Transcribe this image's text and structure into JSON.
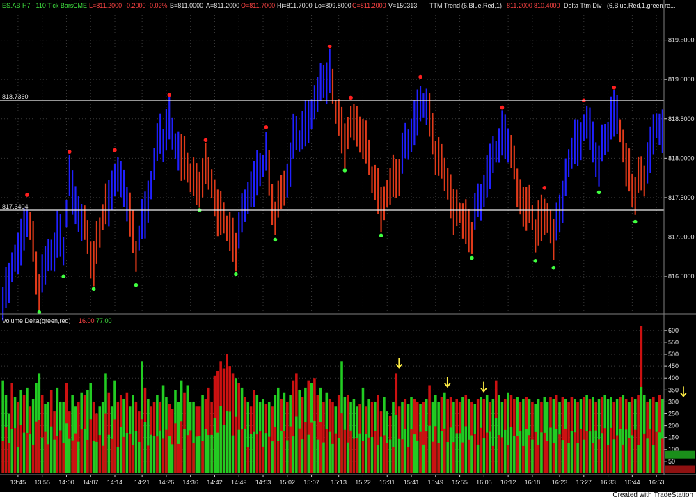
{
  "header": {
    "symbol": "ES.AB H7 - 110 Tick Bars",
    "exchange": "CME",
    "last": "L=811.2000",
    "change": "-0.2000",
    "change_pct": "-0.02%",
    "bid": "B=811.0000",
    "ask": "A=811.2000",
    "open": "O=811.7000",
    "high": "Hi=811.7000",
    "low": "Lo=809.8000",
    "close": "C=811.2000",
    "volume": "V=150313",
    "indicator1": "TTM Trend",
    "indicator1_params": "(6,Blue,Red,1)",
    "indicator1_val1": "811.2000",
    "indicator1_val2": "810.4000",
    "indicator2": "Delta Ttm Div",
    "indicator2_params": "(6,Blue,Red,1,green,re..."
  },
  "volume_header": {
    "title": "Volume Delta",
    "params": "(green,red)",
    "val_red": "16.00",
    "val_green": "77.00"
  },
  "footer_text": "Created with TradeStation",
  "colors": {
    "up_bar": "#2020ff",
    "down_bar": "#e03a1a",
    "delta_green": "#22cc22",
    "delta_red": "#cc1111",
    "dot_red": "#ff2020",
    "dot_green": "#40ff40",
    "arrow": "#ffee44",
    "grid": "#3a3a3a"
  },
  "chart_data": [
    {
      "type": "candlestick",
      "name": "ES.AB H7 - 110 Tick Bars",
      "x_ticks": [
        "13:45",
        "13:55",
        "14:00",
        "14:07",
        "14:14",
        "14:21",
        "14:26",
        "14:36",
        "14:42",
        "14:49",
        "14:53",
        "15:02",
        "15:07",
        "15:13",
        "15:22",
        "15:31",
        "15:41",
        "15:49",
        "15:55",
        "16:05",
        "16:12",
        "16:18",
        "16:23",
        "16:27",
        "16:33",
        "16:44",
        "16:53"
      ],
      "y_ticks": [
        "816.5000",
        "817.0000",
        "817.5000",
        "818.0000",
        "818.5000",
        "819.0000",
        "819.5000"
      ],
      "ylim": [
        816.05,
        819.85
      ],
      "lines": [
        {
          "label": "818.7360",
          "value": 818.736
        },
        {
          "label": "817.3404",
          "value": 817.34
        }
      ],
      "close_path": [
        [
          0,
          816.2,
          "d"
        ],
        [
          6,
          816.95,
          "u"
        ],
        [
          8,
          817.25,
          "u"
        ],
        [
          10,
          816.85,
          "d"
        ],
        [
          12,
          816.4,
          "d"
        ],
        [
          15,
          816.7,
          "u"
        ],
        [
          18,
          817.0,
          "u"
        ],
        [
          20,
          816.9,
          "u"
        ],
        [
          22,
          817.7,
          "u"
        ],
        [
          26,
          817.2,
          "u"
        ],
        [
          30,
          816.7,
          "d"
        ],
        [
          34,
          817.4,
          "d"
        ],
        [
          38,
          817.8,
          "u"
        ],
        [
          41,
          817.5,
          "u"
        ],
        [
          44,
          816.8,
          "d"
        ],
        [
          48,
          817.5,
          "u"
        ],
        [
          52,
          818.3,
          "u"
        ],
        [
          55,
          818.4,
          "u"
        ],
        [
          58,
          818.1,
          "u"
        ],
        [
          61,
          817.9,
          "d"
        ],
        [
          64,
          817.6,
          "d"
        ],
        [
          67,
          817.9,
          "d"
        ],
        [
          70,
          817.5,
          "d"
        ],
        [
          74,
          817.1,
          "d"
        ],
        [
          77,
          816.9,
          "d"
        ],
        [
          80,
          817.4,
          "u"
        ],
        [
          84,
          817.8,
          "u"
        ],
        [
          87,
          818.0,
          "u"
        ],
        [
          90,
          817.3,
          "d"
        ],
        [
          93,
          817.6,
          "d"
        ],
        [
          96,
          818.2,
          "u"
        ],
        [
          100,
          818.4,
          "u"
        ],
        [
          103,
          818.7,
          "u"
        ],
        [
          106,
          819.0,
          "u"
        ],
        [
          108,
          819.1,
          "u"
        ],
        [
          110,
          818.6,
          "d"
        ],
        [
          113,
          818.25,
          "d"
        ],
        [
          116,
          818.45,
          "d"
        ],
        [
          119,
          818.3,
          "d"
        ],
        [
          122,
          817.8,
          "d"
        ],
        [
          125,
          817.4,
          "d"
        ],
        [
          128,
          817.6,
          "d"
        ],
        [
          131,
          817.9,
          "d"
        ],
        [
          134,
          818.2,
          "u"
        ],
        [
          137,
          818.6,
          "u"
        ],
        [
          140,
          818.7,
          "u"
        ],
        [
          143,
          818.1,
          "d"
        ],
        [
          146,
          817.8,
          "d"
        ],
        [
          149,
          817.4,
          "d"
        ],
        [
          152,
          817.2,
          "d"
        ],
        [
          155,
          817.1,
          "d"
        ],
        [
          158,
          817.5,
          "u"
        ],
        [
          161,
          817.9,
          "u"
        ],
        [
          164,
          818.2,
          "u"
        ],
        [
          167,
          818.3,
          "u"
        ],
        [
          170,
          817.6,
          "d"
        ],
        [
          173,
          817.4,
          "d"
        ],
        [
          176,
          817.1,
          "d"
        ],
        [
          179,
          817.3,
          "d"
        ],
        [
          182,
          817.0,
          "d"
        ],
        [
          185,
          817.5,
          "u"
        ],
        [
          188,
          818.1,
          "u"
        ],
        [
          191,
          818.3,
          "u"
        ],
        [
          194,
          818.4,
          "u"
        ],
        [
          197,
          817.9,
          "u"
        ],
        [
          200,
          818.4,
          "u"
        ],
        [
          203,
          818.6,
          "u"
        ],
        [
          206,
          817.9,
          "d"
        ],
        [
          209,
          817.6,
          "d"
        ],
        [
          212,
          817.8,
          "d"
        ],
        [
          215,
          818.3,
          "u"
        ],
        [
          218,
          818.4,
          "u"
        ],
        [
          221,
          818.45,
          "u"
        ],
        [
          224,
          818.7,
          "u"
        ],
        [
          227,
          819.2,
          "u"
        ],
        [
          229,
          819.7,
          "u"
        ],
        [
          231,
          819.6,
          "u"
        ]
      ]
    },
    {
      "type": "bar",
      "name": "Volume Delta",
      "y_ticks": [
        "50",
        "100",
        "150",
        "200",
        "250",
        "300",
        "350",
        "400",
        "450",
        "500",
        "550",
        "600"
      ],
      "ylim": [
        0,
        620
      ],
      "values": [
        390,
        330,
        250,
        380,
        320,
        300,
        350,
        330,
        360,
        280,
        310,
        380,
        420,
        330,
        290,
        300,
        350,
        260,
        360,
        300,
        300,
        380,
        260,
        330,
        280,
        300,
        340,
        330,
        350,
        380,
        300,
        250,
        280,
        300,
        420,
        340,
        280,
        390,
        300,
        330,
        310,
        340,
        280,
        330,
        300,
        260,
        470,
        360,
        310,
        280,
        300,
        330,
        300,
        370,
        320,
        290,
        270,
        350,
        300,
        390,
        340,
        370,
        300,
        300,
        280,
        280,
        330,
        310,
        360,
        300,
        410,
        430,
        470,
        440,
        500,
        450,
        420,
        400,
        380,
        360,
        320,
        300,
        280,
        350,
        330,
        300,
        310,
        290,
        300,
        280,
        330,
        360,
        310,
        340,
        300,
        330,
        390,
        420,
        350,
        320,
        360,
        390,
        380,
        400,
        330,
        360,
        300,
        340,
        310,
        300,
        280,
        330,
        470,
        320,
        330,
        300,
        310,
        280,
        290,
        360,
        280,
        310,
        300,
        300,
        330,
        260,
        320,
        260,
        240,
        300,
        420,
        280,
        300,
        310,
        290,
        320,
        310,
        300,
        290,
        300,
        310,
        370,
        300,
        330,
        300,
        320,
        340,
        310,
        320,
        300,
        310,
        300,
        320,
        330,
        310,
        300,
        290,
        310,
        320,
        310,
        330,
        300,
        310,
        390,
        330,
        300,
        310,
        340,
        330,
        310,
        320,
        300,
        310,
        320,
        310,
        300,
        290,
        310,
        300,
        320,
        300,
        320,
        310,
        330,
        300,
        320,
        310,
        300,
        320,
        310,
        300,
        310,
        320,
        330,
        310,
        320,
        300,
        310,
        320,
        330,
        310,
        320,
        300,
        310,
        320,
        330,
        310,
        300,
        320,
        310,
        330,
        620,
        330,
        300,
        310,
        320,
        300,
        330,
        310
      ],
      "signs": "gggrgrgrgrgggrggrrgggrrggrgrggrrgggrggrrgrggrrgrgrrgrggrrgggrgggrrgrrrrrrrrrrgrgrgrrgggrgrggrgrgrrgrgrgrrgrgrrgrggrgggrgrgrgrrggrgrrgrggrrgrgrgggrgrrgrrgrgrgrgrgrgrggrgrrgrgrgrggrggrgrgrgrrgrgrgrgrgrgggrgrgrgrgrrgrgrgrgrrgrggrgrgrgrgrgrgrrg",
      "arrows": [
        130,
        146,
        158,
        224
      ]
    }
  ]
}
